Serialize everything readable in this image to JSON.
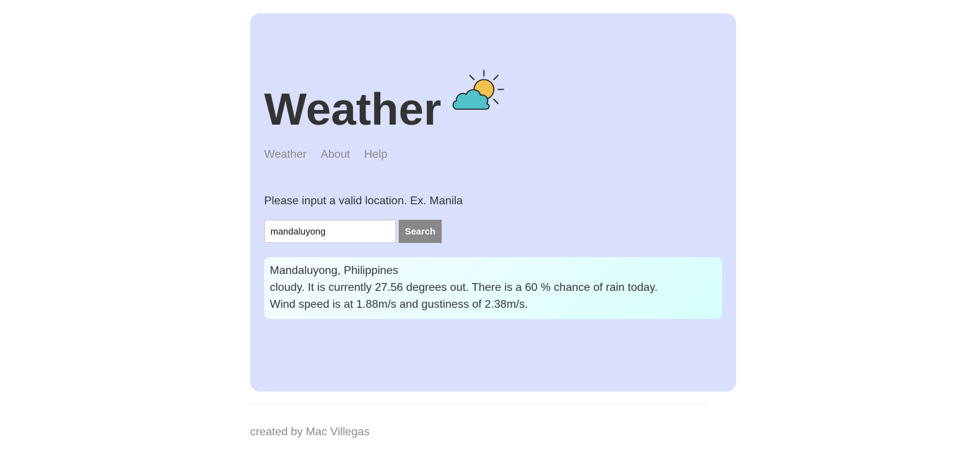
{
  "app": {
    "title": "Weather",
    "logo_icon": "partly-cloudy-icon"
  },
  "nav": {
    "items": [
      {
        "label": "Weather"
      },
      {
        "label": "About"
      },
      {
        "label": "Help"
      }
    ]
  },
  "search": {
    "prompt": "Please input a valid location. Ex. Manila",
    "value": "mandaluyong",
    "button_label": "Search"
  },
  "result": {
    "location": "Mandaluyong, Philippines",
    "conditions": "cloudy. It is currently 27.56 degrees out. There is a 60 % chance of rain today.",
    "wind": "Wind speed is at 1.88m/s and gustiness of 2.38m/s."
  },
  "footer": {
    "credit": "created by Mac Villegas"
  },
  "colors": {
    "card_background": "#d9e0fe",
    "cloud": "#4fc3c8",
    "sun": "#f2c14e",
    "button": "#888888"
  }
}
